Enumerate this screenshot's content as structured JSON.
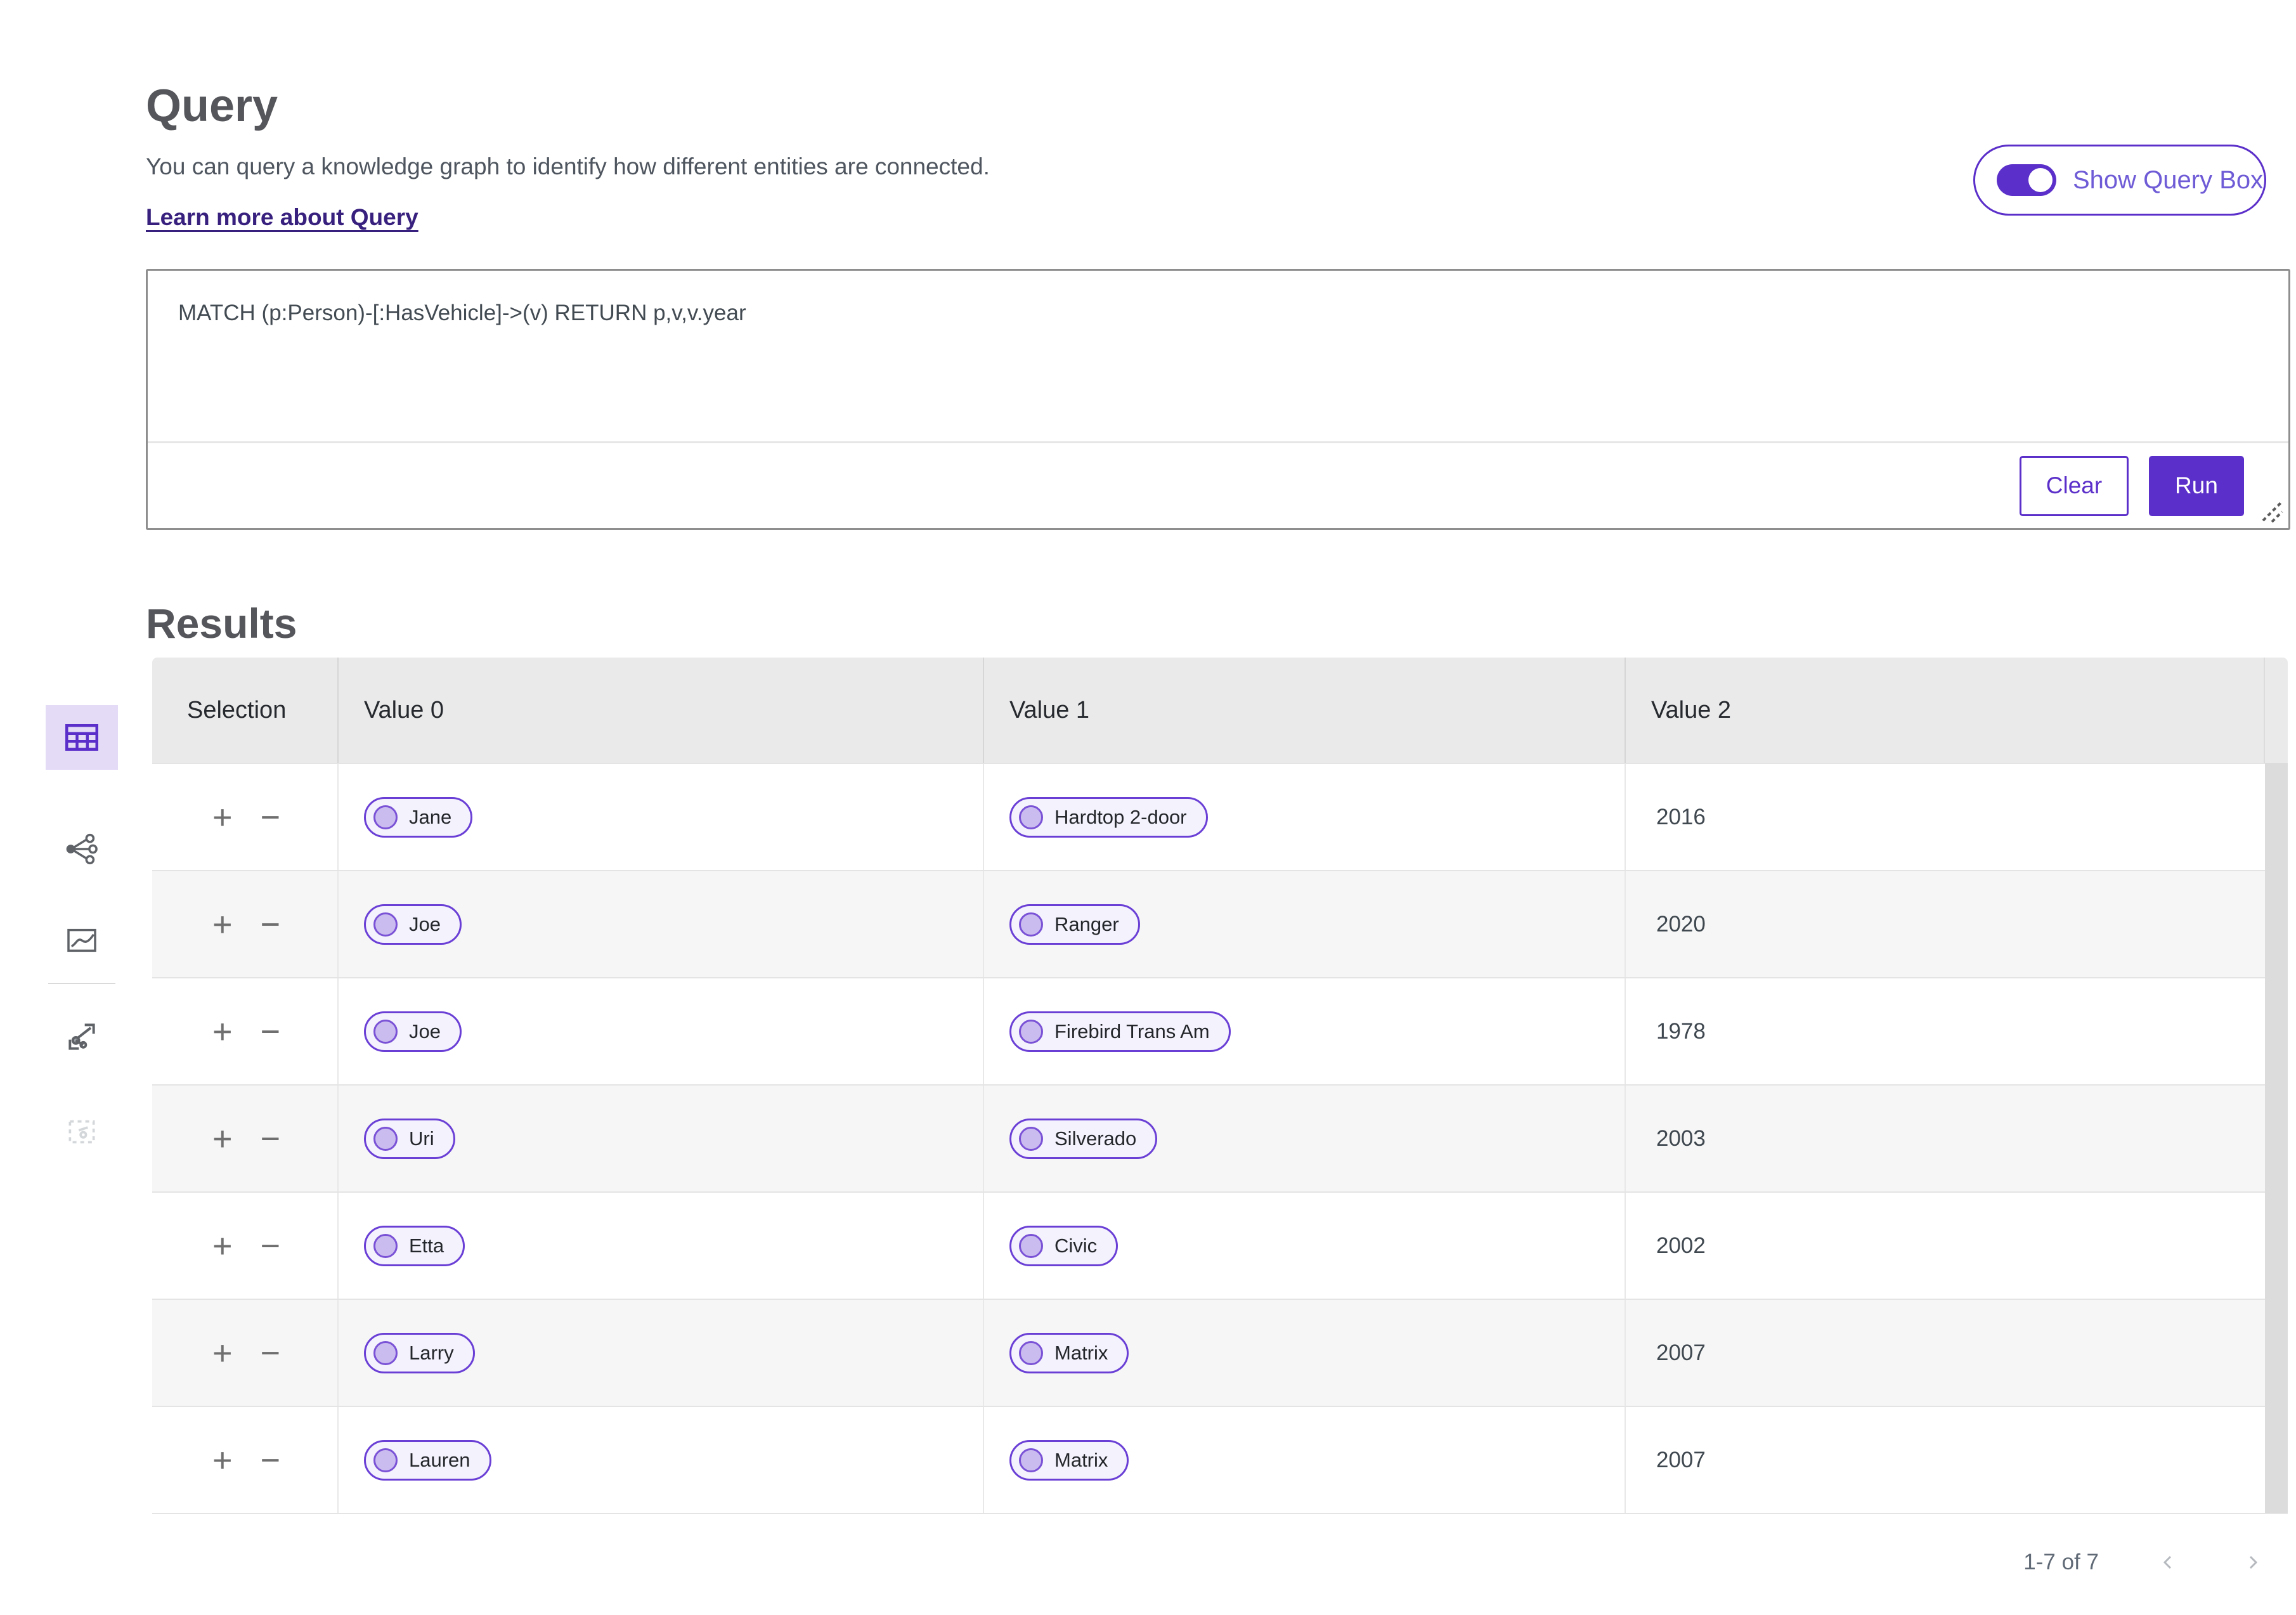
{
  "colors": {
    "accent": "#5b2fc9",
    "pill_border": "#6a3fd6",
    "pill_bg": "#f4f2fc",
    "link": "#38217e"
  },
  "header": {
    "title": "Query",
    "description": "You can query a knowledge graph to identify how different entities are connected.",
    "learn_more": "Learn more about Query",
    "toggle_label": "Show Query Box",
    "toggle_state": "on"
  },
  "query_panel": {
    "query": "MATCH (p:Person)-[:HasVehicle]->(v) RETURN p,v,v.year",
    "clear_label": "Clear",
    "run_label": "Run"
  },
  "sidebar": {
    "icons": [
      "table-view-icon",
      "graph-view-icon",
      "chart-view-icon",
      "graph-selection-icon",
      "empty-view-icon"
    ],
    "selected": "table-view-icon"
  },
  "results": {
    "title": "Results",
    "columns": [
      "Selection",
      "Value 0",
      "Value 1",
      "Value 2"
    ],
    "selection_symbols": {
      "add": "+",
      "remove": "−"
    },
    "rows": [
      {
        "value0": "Jane",
        "value1": "Hardtop 2-door",
        "value2": "2016"
      },
      {
        "value0": "Joe",
        "value1": "Ranger",
        "value2": "2020"
      },
      {
        "value0": "Joe",
        "value1": "Firebird Trans Am",
        "value2": "1978"
      },
      {
        "value0": "Uri",
        "value1": "Silverado",
        "value2": "2003"
      },
      {
        "value0": "Etta",
        "value1": "Civic",
        "value2": "2002"
      },
      {
        "value0": "Larry",
        "value1": "Matrix",
        "value2": "2007"
      },
      {
        "value0": "Lauren",
        "value1": "Matrix",
        "value2": "2007"
      }
    ],
    "pagination": {
      "range": "1-7 of 7"
    }
  }
}
